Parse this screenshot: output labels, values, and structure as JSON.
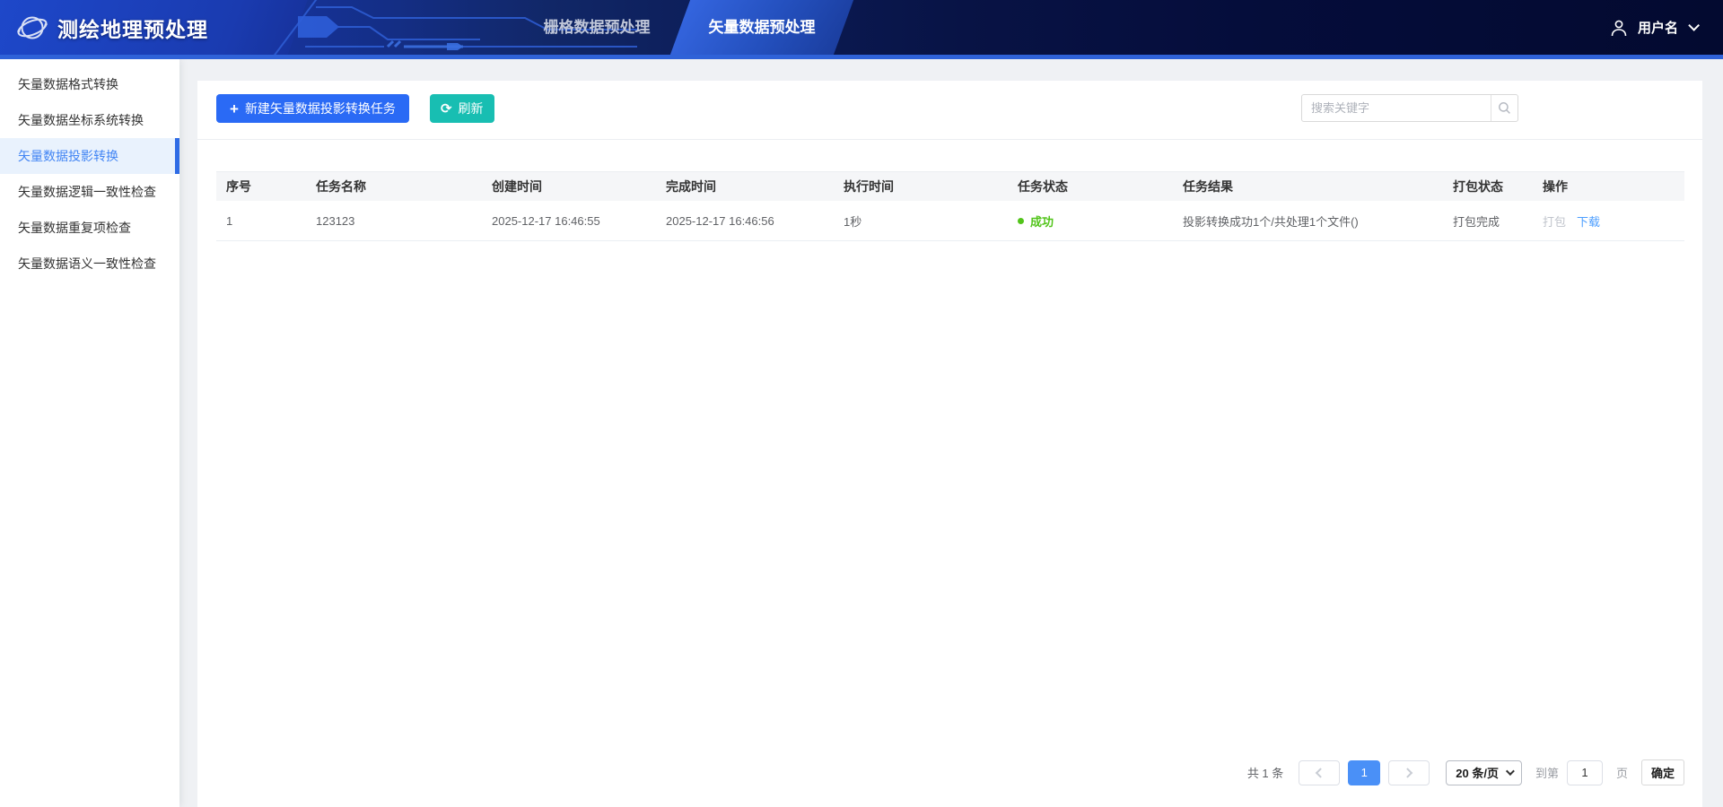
{
  "header": {
    "app_title": "测绘地理预处理",
    "tabs": [
      {
        "label": "栅格数据预处理",
        "active": false
      },
      {
        "label": "矢量数据预处理",
        "active": true
      }
    ],
    "user": {
      "name": "用户名"
    }
  },
  "sidebar": {
    "items": [
      {
        "label": "矢量数据格式转换",
        "active": false
      },
      {
        "label": "矢量数据坐标系统转换",
        "active": false
      },
      {
        "label": "矢量数据投影转换",
        "active": true
      },
      {
        "label": "矢量数据逻辑一致性检查",
        "active": false
      },
      {
        "label": "矢量数据重复项检查",
        "active": false
      },
      {
        "label": "矢量数据语义一致性检查",
        "active": false
      }
    ]
  },
  "toolbar": {
    "plus_glyph": "+",
    "new_task_label": "新建矢量数据投影转换任务",
    "refresh_glyph": "⟳",
    "refresh_label": "刷新",
    "search_placeholder": "搜索关键字"
  },
  "table": {
    "columns": [
      "序号",
      "任务名称",
      "创建时间",
      "完成时间",
      "执行时间",
      "任务状态",
      "任务结果",
      "打包状态",
      "操作"
    ],
    "rows": [
      {
        "index": "1",
        "name": "123123",
        "created": "2025-12-17 16:46:55",
        "finished": "2025-12-17 16:46:56",
        "duration": "1秒",
        "status": "成功",
        "status_color": "#52C41A",
        "result": "投影转换成功1个/共处理1个文件()",
        "package_status": "打包完成",
        "action_package": "打包",
        "action_download": "下载"
      }
    ]
  },
  "pagination": {
    "total": "共 1 条",
    "current_page": "1",
    "page_size": "20 条/页",
    "goto_prefix": "到第",
    "goto_value": "1",
    "goto_suffix": "页",
    "confirm_label": "确定"
  },
  "colors": {
    "accent_blue": "#2A6AF5",
    "accent_teal": "#18BEB2",
    "status_green": "#52C41A",
    "link_blue": "#4C9EFF",
    "header_strip": "#2F62D8"
  }
}
